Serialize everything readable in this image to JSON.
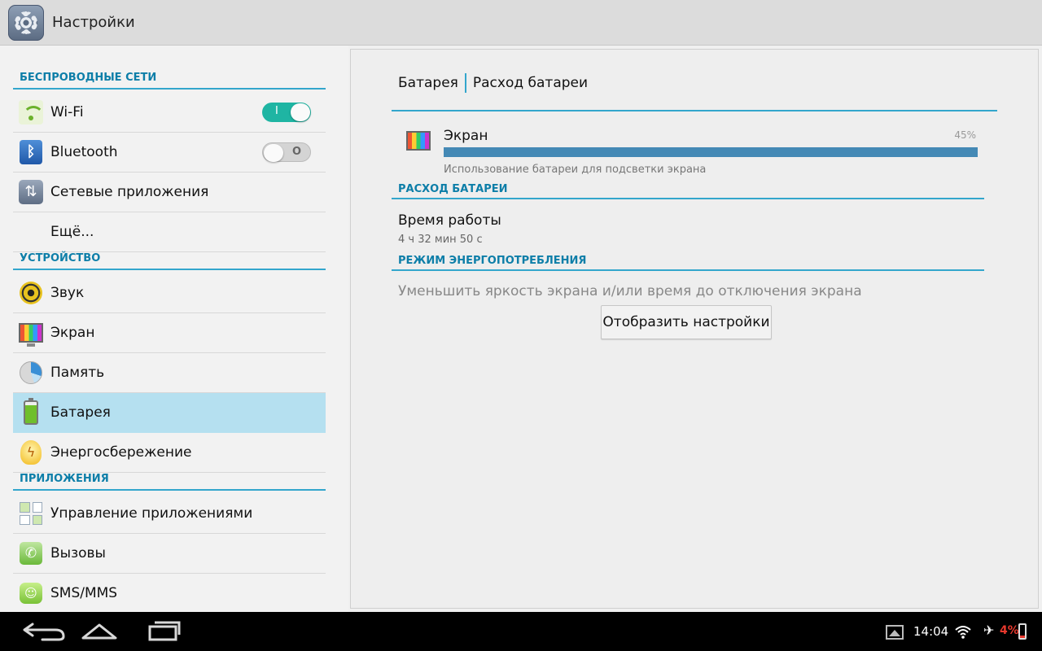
{
  "header": {
    "title": "Настройки",
    "icon": "settings-gear-icon"
  },
  "sidebar": {
    "sections": [
      {
        "title": "БЕСПРОВОДНЫЕ СЕТИ"
      },
      {
        "title": "УСТРОЙСТВО"
      },
      {
        "title": "ПРИЛОЖЕНИЯ"
      }
    ],
    "items": [
      {
        "label": "Wi-Fi",
        "icon": "wifi-icon",
        "toggle": "on",
        "toggle_mark": "I"
      },
      {
        "label": "Bluetooth",
        "icon": "bluetooth-icon",
        "toggle": "off",
        "toggle_mark": "O"
      },
      {
        "label": "Сетевые приложения",
        "icon": "network-apps-icon"
      },
      {
        "label": "Ещё..."
      },
      {
        "label": "Звук",
        "icon": "sound-icon"
      },
      {
        "label": "Экран",
        "icon": "display-icon"
      },
      {
        "label": "Память",
        "icon": "storage-icon"
      },
      {
        "label": "Батарея",
        "icon": "battery-icon",
        "active": true
      },
      {
        "label": "Энергосбережение",
        "icon": "power-saving-icon"
      },
      {
        "label": "Управление приложениями",
        "icon": "apps-icon"
      },
      {
        "label": "Вызовы",
        "icon": "phone-icon"
      },
      {
        "label": "SMS/MMS",
        "icon": "sms-icon"
      }
    ]
  },
  "main": {
    "breadcrumb": [
      "Батарея",
      "Расход батареи"
    ],
    "usage": {
      "name": "Экран",
      "percent_text": "45%",
      "percent_value": 100,
      "description": "Использование батареи для подсветки экрана",
      "icon": "display-icon"
    },
    "section_usage": "РАСХОД БАТАРЕИ",
    "work_title": "Время работы",
    "work_value": "4 ч 32 мин 50 с",
    "section_mode": "РЕЖИМ ЭНЕРГОПОТРЕБЛЕНИЯ",
    "mode_text": "Уменьшить яркость экрана и/или время до отключения экрана",
    "mode_button": "Отобразить настройки"
  },
  "system_bar": {
    "time": "14:04",
    "battery_text": "4%",
    "battery_color": "#e8382d",
    "accent_color": "#33a6cc"
  }
}
